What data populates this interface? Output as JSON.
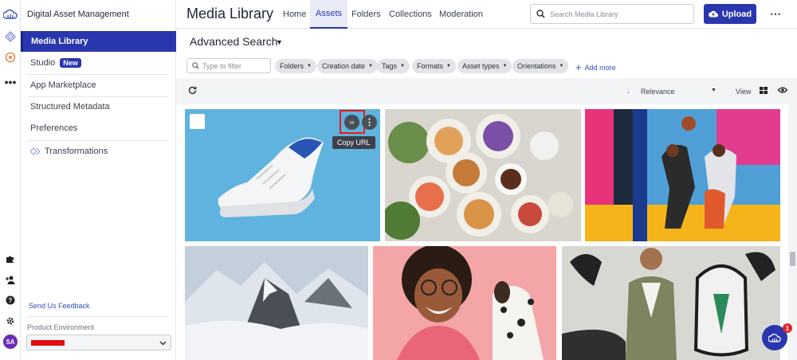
{
  "app": {
    "title": "Digital Asset Management"
  },
  "sidebar": {
    "items": [
      {
        "label": "Media Library"
      },
      {
        "label": "Studio",
        "badge": "New"
      },
      {
        "label": "App Marketplace"
      },
      {
        "label": "Structured Metadata"
      },
      {
        "label": "Preferences"
      },
      {
        "label": "Transformations"
      }
    ],
    "feedback": "Send Us Feedback",
    "environment_label": "Product Environment"
  },
  "header": {
    "title": "Media Library",
    "tabs": [
      {
        "label": "Home"
      },
      {
        "label": "Assets",
        "active": true
      },
      {
        "label": "Folders"
      },
      {
        "label": "Collections"
      },
      {
        "label": "Moderation"
      }
    ],
    "search_placeholder": "Search Media Library",
    "upload_label": "Upload"
  },
  "search": {
    "title": "Advanced Search",
    "filter_placeholder": "Type to filter",
    "chips": [
      {
        "label": "Folders"
      },
      {
        "label": "Creation date"
      },
      {
        "label": "Tags"
      },
      {
        "label": "Formats"
      },
      {
        "label": "Asset types"
      },
      {
        "label": "Orientations"
      }
    ],
    "add_more": "Add more"
  },
  "toolbar": {
    "sort_label": "Relevance",
    "view_label": "View"
  },
  "assets": [
    {
      "subject": "sneaker",
      "color": "#5fb3de"
    },
    {
      "subject": "breakfast-table",
      "color": "#d9d5cf"
    },
    {
      "subject": "basketball-players",
      "color": "#4f9fd6"
    },
    {
      "subject": "mountain-peaks",
      "color": "#c4cfdc"
    },
    {
      "subject": "laughing-woman-with-dog",
      "color": "#f4a5a8"
    },
    {
      "subject": "woman-in-jacket-with-mural",
      "color": "#d8d8d3"
    }
  ],
  "tooltip": "Copy URL",
  "notification_count": "1",
  "user_initials": "SA",
  "colors": {
    "accent": "#2936ad",
    "highlight": "#e81b1b"
  }
}
